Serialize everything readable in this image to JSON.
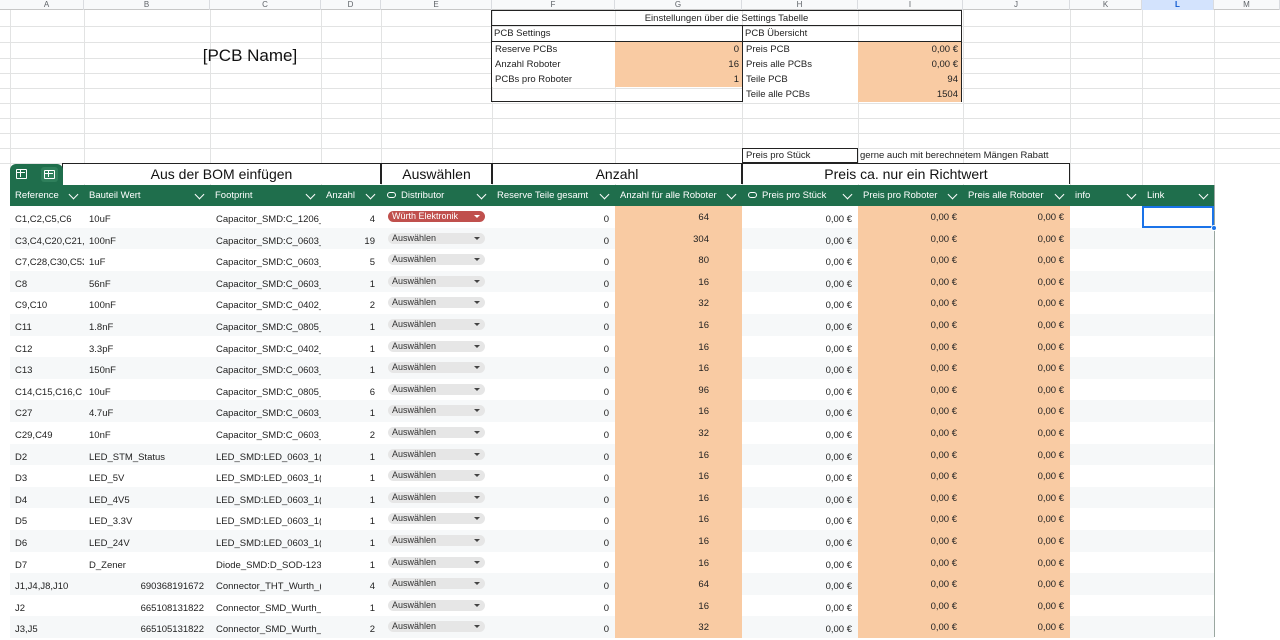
{
  "columns": [
    "A",
    "B",
    "C",
    "D",
    "E",
    "F",
    "G",
    "H",
    "I",
    "J",
    "K",
    "L",
    "M"
  ],
  "pcb_name": "[PCB Name]",
  "settings": {
    "title": "Einstellungen über die Settings Tabelle",
    "left_header": "PCB Settings",
    "right_header": "PCB Übersicht",
    "left_rows": [
      {
        "label": "Reserve PCBs",
        "value": "0"
      },
      {
        "label": "Anzahl Roboter",
        "value": "16"
      },
      {
        "label": "PCBs pro Roboter",
        "value": "1"
      }
    ],
    "right_rows": [
      {
        "label": "Preis PCB",
        "value": "0,00 €"
      },
      {
        "label": "Preis alle PCBs",
        "value": "0,00 €"
      },
      {
        "label": "Teile PCB",
        "value": "94"
      },
      {
        "label": "Teile alle PCBs",
        "value": "1504"
      }
    ]
  },
  "note": {
    "label": "Preis pro Stück",
    "text": "gerne auch mit berechnetem Mängen Rabatt"
  },
  "bands": {
    "bom": "Aus der BOM einfügen",
    "select": "Auswählen",
    "count": "Anzahl",
    "price": "Preis ca. nur ein Richtwert"
  },
  "table_headers": [
    "Reference",
    "Bauteil Wert",
    "Footprint",
    "Anzahl",
    "Distributor",
    "Reserve Teile gesamt",
    "Anzahl für alle Roboter",
    "Preis pro Stück",
    "Preis pro Roboter",
    "Preis alle Roboter",
    "info",
    "Link"
  ],
  "rows": [
    {
      "ref": "C1,C2,C5,C6",
      "val": "10uF",
      "fp": "Capacitor_SMD:C_1206_",
      "qty": "4",
      "dist": "Würth Elektronik",
      "reserve": "0",
      "total": "64",
      "p1": "0,00 €",
      "p2": "0,00 €",
      "p3": "0,00 €"
    },
    {
      "ref": "C3,C4,C20,C21,",
      "val": "100nF",
      "fp": "Capacitor_SMD:C_0603_",
      "qty": "19",
      "dist": "Auswählen",
      "reserve": "0",
      "total": "304",
      "p1": "0,00 €",
      "p2": "0,00 €",
      "p3": "0,00 €"
    },
    {
      "ref": "C7,C28,C30,C53",
      "val": "1uF",
      "fp": "Capacitor_SMD:C_0603_",
      "qty": "5",
      "dist": "Auswählen",
      "reserve": "0",
      "total": "80",
      "p1": "0,00 €",
      "p2": "0,00 €",
      "p3": "0,00 €"
    },
    {
      "ref": "C8",
      "val": "56nF",
      "fp": "Capacitor_SMD:C_0603_",
      "qty": "1",
      "dist": "Auswählen",
      "reserve": "0",
      "total": "16",
      "p1": "0,00 €",
      "p2": "0,00 €",
      "p3": "0,00 €"
    },
    {
      "ref": "C9,C10",
      "val": "100nF",
      "fp": "Capacitor_SMD:C_0402_",
      "qty": "2",
      "dist": "Auswählen",
      "reserve": "0",
      "total": "32",
      "p1": "0,00 €",
      "p2": "0,00 €",
      "p3": "0,00 €"
    },
    {
      "ref": "C11",
      "val": "1.8nF",
      "fp": "Capacitor_SMD:C_0805_",
      "qty": "1",
      "dist": "Auswählen",
      "reserve": "0",
      "total": "16",
      "p1": "0,00 €",
      "p2": "0,00 €",
      "p3": "0,00 €"
    },
    {
      "ref": "C12",
      "val": "3.3pF",
      "fp": "Capacitor_SMD:C_0402_",
      "qty": "1",
      "dist": "Auswählen",
      "reserve": "0",
      "total": "16",
      "p1": "0,00 €",
      "p2": "0,00 €",
      "p3": "0,00 €"
    },
    {
      "ref": "C13",
      "val": "150nF",
      "fp": "Capacitor_SMD:C_0603_",
      "qty": "1",
      "dist": "Auswählen",
      "reserve": "0",
      "total": "16",
      "p1": "0,00 €",
      "p2": "0,00 €",
      "p3": "0,00 €"
    },
    {
      "ref": "C14,C15,C16,C",
      "val": "10uF",
      "fp": "Capacitor_SMD:C_0805_",
      "qty": "6",
      "dist": "Auswählen",
      "reserve": "0",
      "total": "96",
      "p1": "0,00 €",
      "p2": "0,00 €",
      "p3": "0,00 €"
    },
    {
      "ref": "C27",
      "val": "4.7uF",
      "fp": "Capacitor_SMD:C_0603_",
      "qty": "1",
      "dist": "Auswählen",
      "reserve": "0",
      "total": "16",
      "p1": "0,00 €",
      "p2": "0,00 €",
      "p3": "0,00 €"
    },
    {
      "ref": "C29,C49",
      "val": "10nF",
      "fp": "Capacitor_SMD:C_0603_",
      "qty": "2",
      "dist": "Auswählen",
      "reserve": "0",
      "total": "32",
      "p1": "0,00 €",
      "p2": "0,00 €",
      "p3": "0,00 €"
    },
    {
      "ref": "D2",
      "val": "LED_STM_Status",
      "fp": "LED_SMD:LED_0603_1(",
      "qty": "1",
      "dist": "Auswählen",
      "reserve": "0",
      "total": "16",
      "p1": "0,00 €",
      "p2": "0,00 €",
      "p3": "0,00 €"
    },
    {
      "ref": "D3",
      "val": "LED_5V",
      "fp": "LED_SMD:LED_0603_1(",
      "qty": "1",
      "dist": "Auswählen",
      "reserve": "0",
      "total": "16",
      "p1": "0,00 €",
      "p2": "0,00 €",
      "p3": "0,00 €"
    },
    {
      "ref": "D4",
      "val": "LED_4V5",
      "fp": "LED_SMD:LED_0603_1(",
      "qty": "1",
      "dist": "Auswählen",
      "reserve": "0",
      "total": "16",
      "p1": "0,00 €",
      "p2": "0,00 €",
      "p3": "0,00 €"
    },
    {
      "ref": "D5",
      "val": "LED_3.3V",
      "fp": "LED_SMD:LED_0603_1(",
      "qty": "1",
      "dist": "Auswählen",
      "reserve": "0",
      "total": "16",
      "p1": "0,00 €",
      "p2": "0,00 €",
      "p3": "0,00 €"
    },
    {
      "ref": "D6",
      "val": "LED_24V",
      "fp": "LED_SMD:LED_0603_1(",
      "qty": "1",
      "dist": "Auswählen",
      "reserve": "0",
      "total": "16",
      "p1": "0,00 €",
      "p2": "0,00 €",
      "p3": "0,00 €"
    },
    {
      "ref": "D7",
      "val": "D_Zener",
      "fp": "Diode_SMD:D_SOD-123",
      "qty": "1",
      "dist": "Auswählen",
      "reserve": "0",
      "total": "16",
      "p1": "0,00 €",
      "p2": "0,00 €",
      "p3": "0,00 €"
    },
    {
      "ref": "J1,J4,J8,J10",
      "val": "690368191672",
      "fp": "Connector_THT_Wurth_(",
      "qty": "4",
      "dist": "Auswählen",
      "reserve": "0",
      "total": "64",
      "p1": "0,00 €",
      "p2": "0,00 €",
      "p3": "0,00 €",
      "num": true
    },
    {
      "ref": "J2",
      "val": "665108131822",
      "fp": "Connector_SMD_Wurth_",
      "qty": "1",
      "dist": "Auswählen",
      "reserve": "0",
      "total": "16",
      "p1": "0,00 €",
      "p2": "0,00 €",
      "p3": "0,00 €",
      "num": true
    },
    {
      "ref": "J3,J5",
      "val": "665105131822",
      "fp": "Connector_SMD_Wurth_",
      "qty": "2",
      "dist": "Auswählen",
      "reserve": "0",
      "total": "32",
      "p1": "0,00 €",
      "p2": "0,00 €",
      "p3": "0,00 €",
      "num": true
    }
  ],
  "colors": {
    "header_green": "#1f6e4c",
    "peach": "#f9cba3",
    "chip_red": "#c0504d",
    "selection_blue": "#1a73e8"
  }
}
